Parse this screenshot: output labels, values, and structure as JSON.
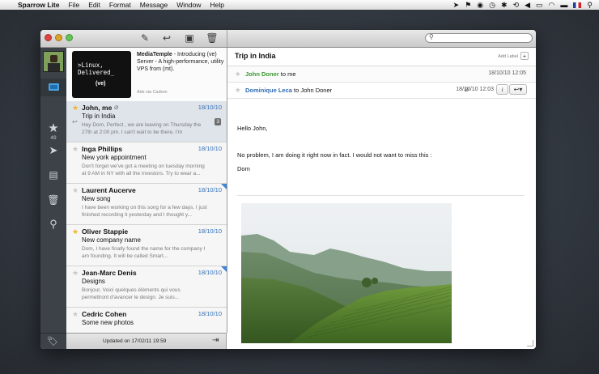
{
  "menubar": {
    "app_name": "Sparrow Lite",
    "items": [
      "File",
      "Edit",
      "Format",
      "Message",
      "Window",
      "Help"
    ]
  },
  "toolbar": {
    "search_placeholder": ""
  },
  "sidebar": {
    "starred_count": "49"
  },
  "ad": {
    "image_line1": ">Linux, Delivered_",
    "image_line2": "(ve)",
    "sponsor": "MediaTemple",
    "text": " - Introducing (ve) Server - A high-performance, utility VPS from (mt).",
    "via": "Ads via Carbon"
  },
  "messages": [
    {
      "from": "John, me",
      "date": "18/10/10",
      "subject": "Trip in India",
      "preview": "Hey Dom, Perfect , we are leaving on Thursday the 27th at 2:00 pm. I can't wait to be there. I'm",
      "starred": true,
      "attachment": true,
      "replied": true,
      "count": "3",
      "unread": false
    },
    {
      "from": "Inga Phillips",
      "date": "18/10/10",
      "subject": "New york appointment",
      "preview": "Don't forget we've got a meeting on tuesday morning at 9 AM in NY with all the investors. Try to wear a...",
      "starred": false,
      "unread": false
    },
    {
      "from": "Laurent Aucerve",
      "date": "18/10/10",
      "subject": "New song",
      "preview": "I have been working on this song for a few days. I just finished recording it yesterday and I thought y...",
      "starred": false,
      "unread": true
    },
    {
      "from": "Oliver Stappie",
      "date": "18/10/10",
      "subject": "New company name",
      "preview": "Dom, I have finally found the name for the company I am founding. It will be called Smart...",
      "starred": true,
      "unread": false
    },
    {
      "from": "Jean-Marc Denis",
      "date": "18/10/10",
      "subject": "Designs",
      "preview": "Bonjour, Voici quelques éléments qui vous permettront d'avancer le design. Je suis...",
      "starred": false,
      "unread": true
    },
    {
      "from": "Cedric Cohen",
      "date": "18/10/10",
      "subject": "Some new photos",
      "preview": "",
      "starred": false,
      "unread": false
    }
  ],
  "list_footer": {
    "updated": "Updated on 17/02/11 19:59"
  },
  "reader": {
    "thread_title": "Trip in India",
    "add_label": "Add Label",
    "add_label_plus": "+",
    "row1": {
      "from": "John Doner",
      "to_text": " to me",
      "date": "18/10/10 12:05"
    },
    "row2": {
      "from": "Dominique Leca",
      "to_text": " to John Doner",
      "date": "18/10/10 12:03",
      "info_label": "i",
      "reply_label": "↩▾"
    },
    "body": {
      "greeting": "Hello John,",
      "line": "No problem, I am doing it right now in fact. I would not want to miss this :",
      "signature": "Dom"
    }
  },
  "colors": {
    "accent_blue": "#2f6db5",
    "from_green": "#3a9a2e",
    "star_on": "#f0b429",
    "sidebar_bg": "#3d4248"
  }
}
